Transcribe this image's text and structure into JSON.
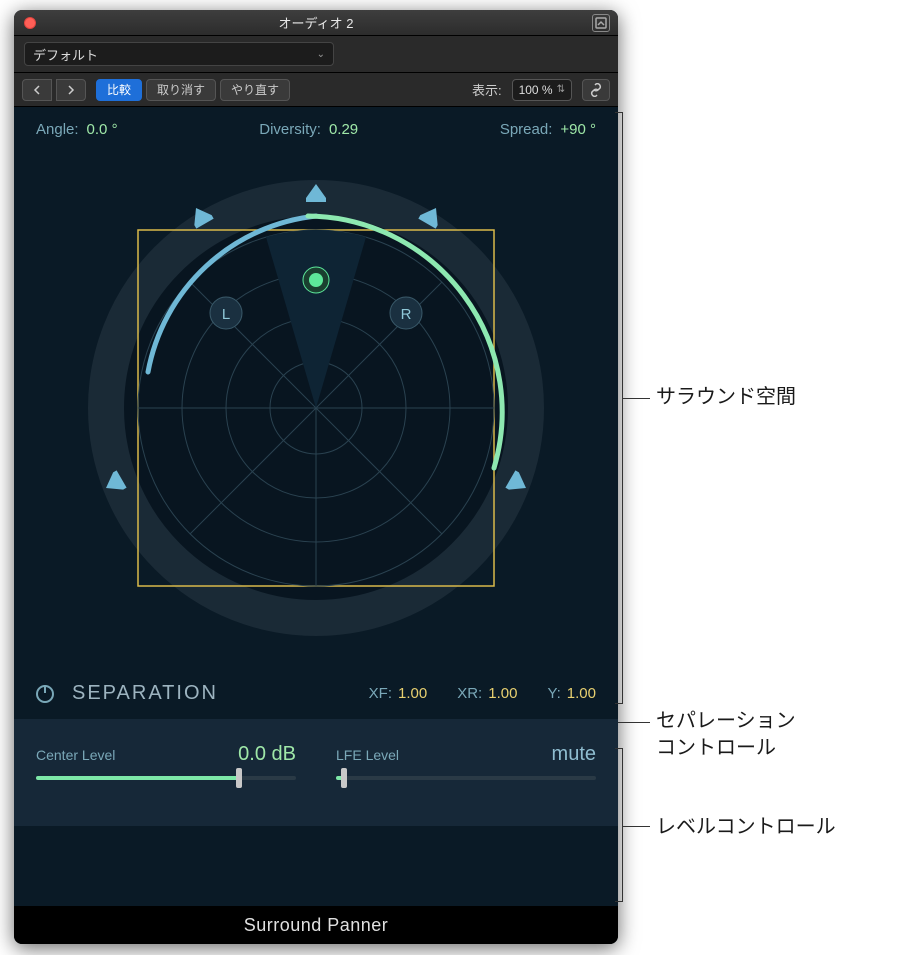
{
  "titlebar": {
    "title": "オーディオ 2"
  },
  "preset": {
    "selected": "デフォルト"
  },
  "toolbar": {
    "compare": "比較",
    "undo": "取り消す",
    "redo": "やり直す",
    "view_label": "表示:",
    "zoom": "100 %"
  },
  "params": {
    "angle_label": "Angle:",
    "angle_value": "0.0 °",
    "diversity_label": "Diversity:",
    "diversity_value": "0.29",
    "spread_label": "Spread:",
    "spread_value": "+90 °"
  },
  "field": {
    "left_marker": "L",
    "right_marker": "R"
  },
  "separation": {
    "title": "SEPARATION",
    "xf_label": "XF:",
    "xf_value": "1.00",
    "xr_label": "XR:",
    "xr_value": "1.00",
    "y_label": "Y:",
    "y_value": "1.00"
  },
  "levels": {
    "center_label": "Center Level",
    "center_value": "0.0 dB",
    "lfe_label": "LFE Level",
    "lfe_value": "mute"
  },
  "footer": {
    "title": "Surround Panner"
  },
  "callouts": {
    "surround_field": "サラウンド空間",
    "separation_controls": "セパレーション\nコントロール",
    "level_controls": "レベルコントロール"
  }
}
